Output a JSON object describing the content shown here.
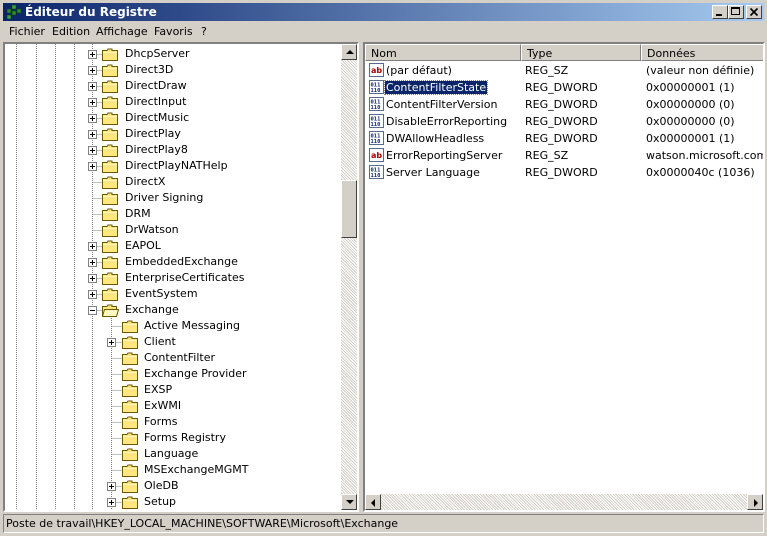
{
  "window": {
    "title": "Éditeur du Registre"
  },
  "menu": [
    "Fichier",
    "Edition",
    "Affichage",
    "Favoris",
    "?"
  ],
  "tree": {
    "items": [
      {
        "label": "DhcpServer",
        "level": 0,
        "expander": "plus"
      },
      {
        "label": "Direct3D",
        "level": 0,
        "expander": "plus"
      },
      {
        "label": "DirectDraw",
        "level": 0,
        "expander": "plus"
      },
      {
        "label": "DirectInput",
        "level": 0,
        "expander": "plus"
      },
      {
        "label": "DirectMusic",
        "level": 0,
        "expander": "plus"
      },
      {
        "label": "DirectPlay",
        "level": 0,
        "expander": "plus"
      },
      {
        "label": "DirectPlay8",
        "level": 0,
        "expander": "plus"
      },
      {
        "label": "DirectPlayNATHelp",
        "level": 0,
        "expander": "plus"
      },
      {
        "label": "DirectX",
        "level": 0,
        "expander": "none"
      },
      {
        "label": "Driver Signing",
        "level": 0,
        "expander": "none"
      },
      {
        "label": "DRM",
        "level": 0,
        "expander": "none"
      },
      {
        "label": "DrWatson",
        "level": 0,
        "expander": "none"
      },
      {
        "label": "EAPOL",
        "level": 0,
        "expander": "plus"
      },
      {
        "label": "EmbeddedExchange",
        "level": 0,
        "expander": "plus"
      },
      {
        "label": "EnterpriseCertificates",
        "level": 0,
        "expander": "plus"
      },
      {
        "label": "EventSystem",
        "level": 0,
        "expander": "plus"
      },
      {
        "label": "Exchange",
        "level": 0,
        "expander": "minus",
        "open": true
      },
      {
        "label": "Active Messaging",
        "level": 1,
        "expander": "none"
      },
      {
        "label": "Client",
        "level": 1,
        "expander": "plus"
      },
      {
        "label": "ContentFilter",
        "level": 1,
        "expander": "none"
      },
      {
        "label": "Exchange Provider",
        "level": 1,
        "expander": "none"
      },
      {
        "label": "EXSP",
        "level": 1,
        "expander": "none"
      },
      {
        "label": "ExWMI",
        "level": 1,
        "expander": "none"
      },
      {
        "label": "Forms",
        "level": 1,
        "expander": "none"
      },
      {
        "label": "Forms Registry",
        "level": 1,
        "expander": "none"
      },
      {
        "label": "Language",
        "level": 1,
        "expander": "none"
      },
      {
        "label": "MSExchangeMGMT",
        "level": 1,
        "expander": "none"
      },
      {
        "label": "OleDB",
        "level": 1,
        "expander": "plus"
      },
      {
        "label": "Setup",
        "level": 1,
        "expander": "plus"
      }
    ],
    "scroll_position": 0.32
  },
  "list": {
    "columns": [
      "Nom",
      "Type",
      "Données"
    ],
    "rows": [
      {
        "name": "(par défaut)",
        "type": "REG_SZ",
        "data": "(valeur non définie)",
        "icon": "string-value-icon",
        "selected": false
      },
      {
        "name": "ContentFilterState",
        "type": "REG_DWORD",
        "data": "0x00000001 (1)",
        "icon": "binary-value-icon",
        "selected": true
      },
      {
        "name": "ContentFilterVersion",
        "type": "REG_DWORD",
        "data": "0x00000000 (0)",
        "icon": "binary-value-icon",
        "selected": false
      },
      {
        "name": "DisableErrorReporting",
        "type": "REG_DWORD",
        "data": "0x00000000 (0)",
        "icon": "binary-value-icon",
        "selected": false
      },
      {
        "name": "DWAllowHeadless",
        "type": "REG_DWORD",
        "data": "0x00000001 (1)",
        "icon": "binary-value-icon",
        "selected": false
      },
      {
        "name": "ErrorReportingServer",
        "type": "REG_SZ",
        "data": "watson.microsoft.com",
        "icon": "string-value-icon",
        "selected": false
      },
      {
        "name": "Server Language",
        "type": "REG_DWORD",
        "data": "0x0000040c (1036)",
        "icon": "binary-value-icon",
        "selected": false
      }
    ]
  },
  "status": {
    "path": "Poste de travail\\HKEY_LOCAL_MACHINE\\SOFTWARE\\Microsoft\\Exchange"
  },
  "colors": {
    "title_start": "#0a246a",
    "title_end": "#a6caf0",
    "selection": "#0a246a",
    "folder": "#ffe680",
    "face": "#d4d0c8"
  }
}
